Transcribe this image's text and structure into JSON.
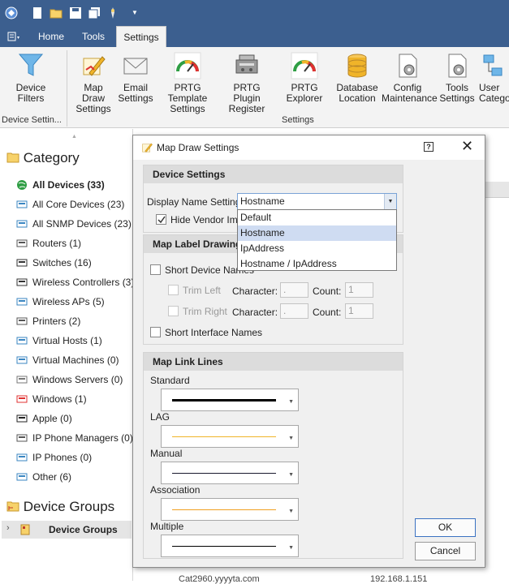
{
  "tabs": {
    "home": "Home",
    "tools": "Tools",
    "settings": "Settings"
  },
  "ribbon": {
    "device_filters": [
      "Device",
      "Filters"
    ],
    "map_draw_settings": [
      "Map Draw",
      "Settings"
    ],
    "email_settings": [
      "Email",
      "Settings"
    ],
    "prtg_template_settings": [
      "PRTG Template",
      "Settings"
    ],
    "prtg_plugin_register": [
      "PRTG Plugin",
      "Register"
    ],
    "prtg_explorer": [
      "PRTG Explorer"
    ],
    "database_location": [
      "Database",
      "Location"
    ],
    "config_maintenance": [
      "Config",
      "Maintenance"
    ],
    "tools_settings": [
      "Tools",
      "Settings"
    ],
    "user_category": [
      "User",
      "Catego"
    ],
    "group_device_settings": "Device Settin...",
    "group_settings": "Settings"
  },
  "left": {
    "category_header": "Category",
    "items": [
      {
        "label": "All Devices (33)",
        "icon": "globe-icon",
        "bold": true
      },
      {
        "label": "All Core Devices (23)",
        "icon": "core-device-icon"
      },
      {
        "label": "All SNMP Devices (23)",
        "icon": "snmp-device-icon"
      },
      {
        "label": "Routers (1)",
        "icon": "router-icon"
      },
      {
        "label": "Switches (16)",
        "icon": "switch-icon"
      },
      {
        "label": "Wireless Controllers (3)",
        "icon": "wireless-controller-icon"
      },
      {
        "label": "Wireless APs (5)",
        "icon": "wireless-ap-icon"
      },
      {
        "label": "Printers (2)",
        "icon": "printer-icon"
      },
      {
        "label": "Virtual Hosts (1)",
        "icon": "virtual-host-icon"
      },
      {
        "label": "Virtual Machines (0)",
        "icon": "virtual-machine-icon"
      },
      {
        "label": "Windows Servers (0)",
        "icon": "windows-server-icon"
      },
      {
        "label": "Windows (1)",
        "icon": "windows-icon"
      },
      {
        "label": "Apple (0)",
        "icon": "apple-icon"
      },
      {
        "label": "IP Phone Managers (0)",
        "icon": "ip-phone-manager-icon"
      },
      {
        "label": "IP Phones (0)",
        "icon": "ip-phone-icon"
      },
      {
        "label": "Other (6)",
        "icon": "other-icon"
      }
    ],
    "device_groups_header": "Device Groups",
    "device_groups_row": "Device Groups"
  },
  "dialog": {
    "title": "Map Draw Settings",
    "device_settings": {
      "header": "Device Settings",
      "display_name_label": "Display Name Setting:",
      "display_name_value": "Hostname",
      "options": [
        "Default",
        "Hostname",
        "IpAddress",
        "Hostname / IpAddress"
      ],
      "selected_option": "Hostname",
      "hide_vendor_label": "Hide Vendor Imag",
      "hide_vendor_checked": true
    },
    "map_label": {
      "header": "Map Label Drawing",
      "short_device_names": "Short Device Names",
      "trim_left": "Trim Left",
      "trim_right": "Trim Right",
      "character_label": "Character:",
      "count_label": "Count:",
      "trim_left_char": ".",
      "trim_left_count": "1",
      "trim_right_char": ".",
      "trim_right_count": "1",
      "short_interface_names": "Short Interface Names"
    },
    "map_link": {
      "header": "Map Link Lines",
      "lines": [
        {
          "label": "Standard",
          "color": "#000000",
          "thickness": "thick"
        },
        {
          "label": "LAG",
          "color": "#f0b429",
          "thickness": "thin"
        },
        {
          "label": "Manual",
          "color": "#1a1a2e",
          "thickness": "thin"
        },
        {
          "label": "Association",
          "color": "#f0a020",
          "thickness": "thin"
        },
        {
          "label": "Multiple",
          "color": "#000000",
          "thickness": "thin"
        }
      ]
    },
    "ok_label": "OK",
    "cancel_label": "Cancel"
  },
  "background": {
    "bottom_row_left": "Cat2960.yyyyta.com",
    "bottom_row_right": "192.168.1.151"
  }
}
